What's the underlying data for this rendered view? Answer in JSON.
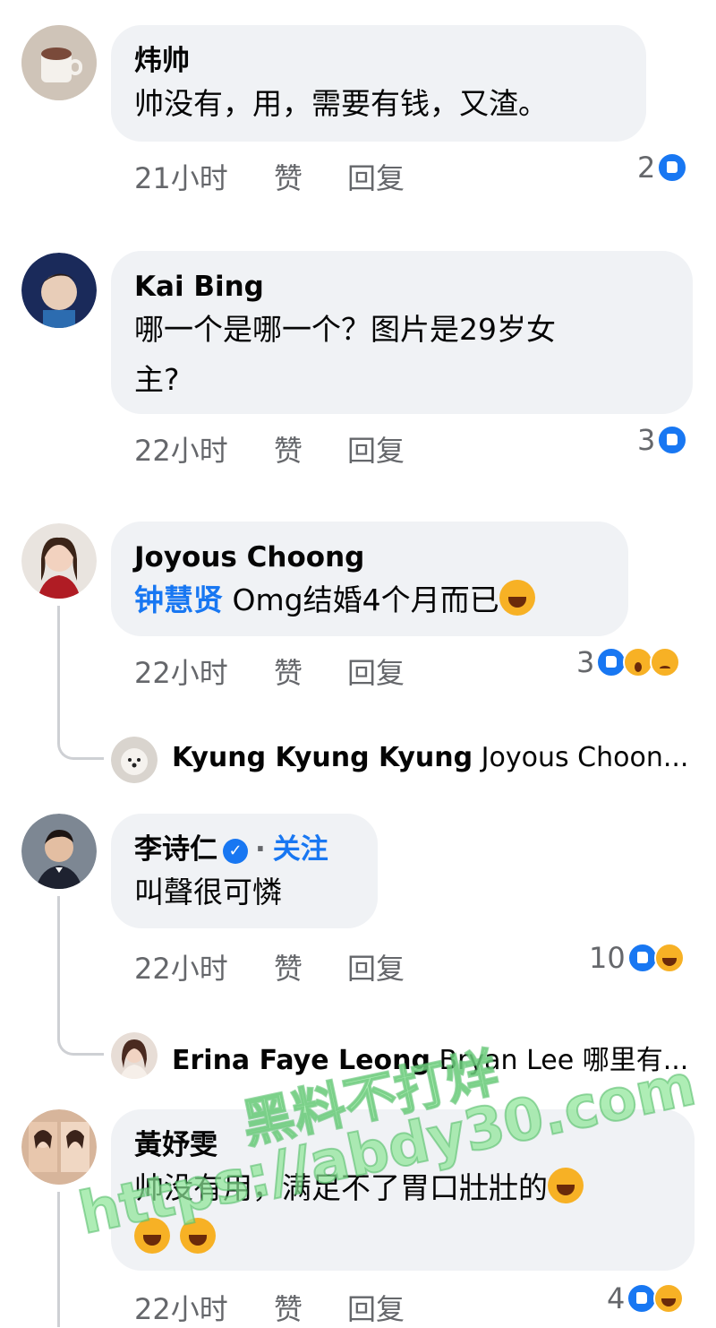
{
  "comments": [
    {
      "author": "炜帅",
      "text": "帅没有，用，需要有钱，又渣。",
      "time": "21小时",
      "like_label": "赞",
      "reply_label": "回复",
      "reaction_count": "2"
    },
    {
      "author": "Kai Bing",
      "text_line1": "哪一个是哪一个？图片是29岁女",
      "text_line2": "主?",
      "time": "22小时",
      "like_label": "赞",
      "reply_label": "回复",
      "reaction_count": "3"
    },
    {
      "author": "Joyous Choong",
      "mention": "钟慧贤",
      "text": "Omg结婚4个月而已",
      "time": "22小时",
      "like_label": "赞",
      "reply_label": "回复",
      "reaction_count": "3",
      "reply_preview": {
        "author": "Kyung Kyung Kyung",
        "text": "Joyous Choon..."
      }
    },
    {
      "author": "李诗仁",
      "follow_label": "关注",
      "text": "叫聲很可憐",
      "time": "22小时",
      "like_label": "赞",
      "reply_label": "回复",
      "reaction_count": "10",
      "reply_preview": {
        "author": "Erina Faye Leong",
        "text": "Bryan Lee 哪里有..."
      }
    },
    {
      "author": "黃妤雯",
      "text_line1": "帅没有用，满足不了胃口壯壯的",
      "time": "22小时",
      "like_label": "赞",
      "reply_label": "回复",
      "reaction_count": "4"
    }
  ],
  "watermark": {
    "line1": "黑料不打烊",
    "line2": "https://abdy30.com"
  },
  "colors": {
    "bubble": "#f0f2f5",
    "meta": "#65676b",
    "accent": "#1877f2"
  }
}
